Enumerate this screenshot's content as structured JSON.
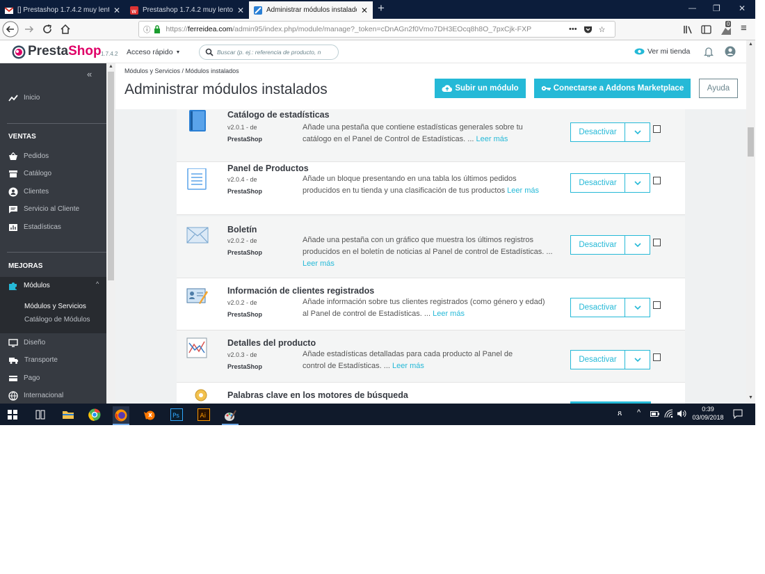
{
  "browser": {
    "tabs": [
      {
        "title": "[] Prestashop 1.7.4.2 muy lento"
      },
      {
        "title": "Prestashop 1.7.4.2 muy lento e"
      },
      {
        "title": "Administrar módulos instalado"
      }
    ],
    "url_prefix": "https://",
    "url_domain": "ferreidea.com",
    "url_path": "/admin95/index.php/module/manage?_token=cDnAGn2f0Vmo7DH3EOcq8h8O_7pxCjk-FXP",
    "url_more": "•••",
    "notif_count": "0"
  },
  "header": {
    "brand": "PrestaShop",
    "version": "1.7.4.2",
    "quick_access": "Acceso rápido",
    "search_placeholder": "Buscar (p. ej.: referencia de producto, n",
    "view_store": "Ver mi tienda"
  },
  "sidebar": {
    "home": "Inicio",
    "sections": [
      {
        "title": "VENTAS",
        "items": [
          "Pedidos",
          "Catálogo",
          "Clientes",
          "Servicio al Cliente",
          "Estadísticas"
        ]
      },
      {
        "title": "MEJORAS",
        "items": [
          "Módulos"
        ]
      }
    ],
    "modules_sub": [
      "Módulos y Servicios",
      "Catálogo de Módulos"
    ],
    "more_items": [
      "Diseño",
      "Transporte",
      "Pago",
      "Internacional"
    ]
  },
  "page": {
    "breadcrumb": [
      "Módulos y Servicios",
      "Módulos instalados"
    ],
    "title": "Administrar módulos instalados",
    "upload_btn": "Subir un módulo",
    "addons_btn": "Conectarse a Addons Marketplace",
    "help_btn": "Ayuda"
  },
  "modules": [
    {
      "name": "Catálogo de estadísticas",
      "version": "v2.0.1 - de",
      "author": "PrestaShop",
      "desc": "Añade una pestaña que contiene estadísticas generales sobre tu catálogo en el Panel de Control de Estadísticas. ...",
      "more": "Leer más",
      "action": "Desactivar",
      "icon": "book-icon"
    },
    {
      "name": "Panel de Productos",
      "version": "v2.0.4 - de",
      "author": "PrestaShop",
      "desc": "Añade un bloque presentando en una tabla los últimos pedidos producidos en tu tienda y una clasificación de tus productos",
      "more": "Leer más",
      "action": "Desactivar",
      "icon": "list-icon"
    },
    {
      "name": "Boletín",
      "version": "v2.0.2 - de",
      "author": "PrestaShop",
      "desc": "Añade una pestaña con un gráfico que muestra los últimos registros producidos en el boletín de noticias al Panel de control de Estadísticas. ...",
      "more": "Leer más",
      "action": "Desactivar",
      "icon": "envelope-icon"
    },
    {
      "name": "Información de clientes registrados",
      "version": "v2.0.2 - de",
      "author": "PrestaShop",
      "desc": "Añade información sobre tus clientes registrados (como género y edad) al Panel de control de Estadísticas. ...",
      "more": "Leer más",
      "action": "Desactivar",
      "icon": "id-card-icon"
    },
    {
      "name": "Detalles del producto",
      "version": "v2.0.3 - de",
      "author": "PrestaShop",
      "desc": "Añade estadísticas detalladas para cada producto al Panel de control de Estadísticas. ...",
      "more": "Leer más",
      "action": "Desactivar",
      "icon": "chart-icon"
    },
    {
      "name": "Palabras clave en los motores de búsqueda",
      "icon": "key-icon"
    }
  ],
  "taskbar": {
    "time": "0:39",
    "date": "03/09/2018"
  }
}
